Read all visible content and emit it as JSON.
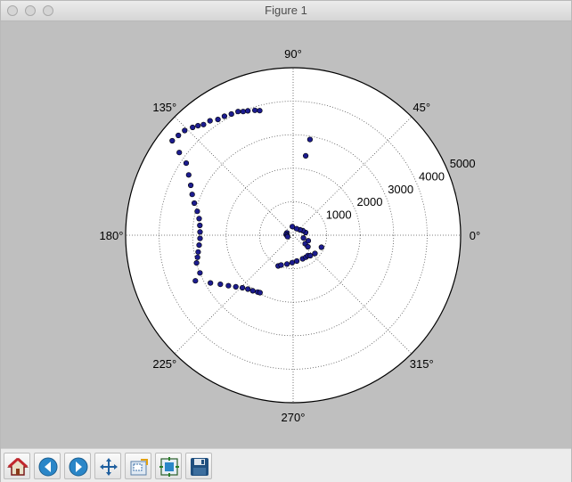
{
  "window": {
    "title": "Figure 1"
  },
  "toolbar": {
    "buttons": [
      {
        "name": "home-button",
        "icon": "home-icon"
      },
      {
        "name": "back-button",
        "icon": "back-arrow-icon"
      },
      {
        "name": "forward-button",
        "icon": "forward-arrow-icon"
      },
      {
        "name": "pan-button",
        "icon": "move-arrows-icon"
      },
      {
        "name": "zoom-button",
        "icon": "zoom-rect-icon"
      },
      {
        "name": "configure-subplots-button",
        "icon": "subplots-icon"
      },
      {
        "name": "save-button",
        "icon": "floppy-disk-icon"
      }
    ]
  },
  "chart_data": {
    "type": "scatter",
    "projection": "polar",
    "rlim": [
      0,
      5000
    ],
    "radial_ticks": [
      "1000",
      "2000",
      "3000",
      "4000",
      "5000"
    ],
    "angle_ticks": [
      "0°",
      "45°",
      "90°",
      "135°",
      "180°",
      "225°",
      "270°",
      "315°"
    ],
    "grid": true,
    "marker_color": "#1c1c8f",
    "series": [
      {
        "points": [
          [
            105,
            3850
          ],
          [
            107,
            3900
          ],
          [
            110,
            3950
          ],
          [
            112,
            3980
          ],
          [
            114,
            4040
          ],
          [
            117,
            4060
          ],
          [
            120,
            4100
          ],
          [
            123,
            4120
          ],
          [
            126,
            4220
          ],
          [
            129,
            4250
          ],
          [
            131,
            4330
          ],
          [
            133,
            4400
          ],
          [
            136,
            4500
          ],
          [
            139,
            4540
          ],
          [
            142,
            4580
          ],
          [
            80,
            2900
          ],
          [
            81,
            2400
          ],
          [
            144,
            4200
          ],
          [
            146,
            3850
          ],
          [
            150,
            3600
          ],
          [
            154,
            3400
          ],
          [
            158,
            3250
          ],
          [
            162,
            3100
          ],
          [
            166,
            2950
          ],
          [
            170,
            2850
          ],
          [
            174,
            2800
          ],
          [
            178,
            2780
          ],
          [
            182,
            2780
          ],
          [
            186,
            2820
          ],
          [
            190,
            2880
          ],
          [
            193,
            2930
          ],
          [
            196,
            3000
          ],
          [
            202,
            3000
          ],
          [
            205,
            3220
          ],
          [
            210,
            2850
          ],
          [
            214,
            2620
          ],
          [
            218,
            2450
          ],
          [
            222,
            2300
          ],
          [
            226,
            2180
          ],
          [
            230,
            2100
          ],
          [
            234,
            2050
          ],
          [
            238,
            2000
          ],
          [
            240,
            1980
          ],
          [
            244,
            1020
          ],
          [
            248,
            960
          ],
          [
            258,
            880
          ],
          [
            268,
            820
          ],
          [
            278,
            780
          ],
          [
            292,
            760
          ],
          [
            300,
            760
          ],
          [
            306,
            750
          ],
          [
            337,
            920
          ],
          [
            310,
            800
          ],
          [
            320,
            850
          ],
          [
            12,
            380
          ],
          [
            25,
            320
          ],
          [
            38,
            260
          ],
          [
            62,
            220
          ],
          [
            95,
            260
          ],
          [
            160,
            200
          ],
          [
            174,
            210
          ],
          [
            185,
            180
          ],
          [
            195,
            170
          ],
          [
            345,
            320
          ],
          [
            325,
            440
          ],
          [
            322,
            560
          ],
          [
            340,
            480
          ]
        ]
      }
    ]
  }
}
